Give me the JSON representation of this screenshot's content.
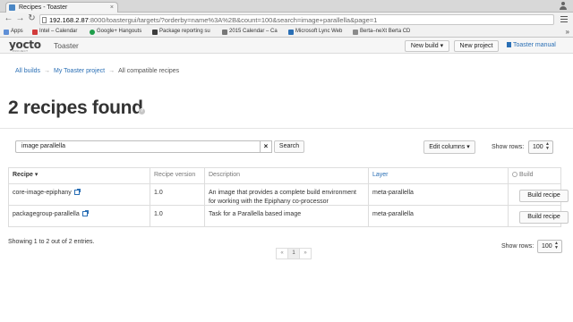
{
  "browser": {
    "tab_title": "Recipes - Toaster",
    "url_host": "192.168.2.87",
    "url_path": ":8000/toastergui/targets/?orderby=name%3A%2B&count=100&search=image+parallella&page=1",
    "bookmarks": [
      {
        "label": "Apps",
        "color": "#5f8fd6"
      },
      {
        "label": "Intel – Calendar",
        "color": "#d23b3b"
      },
      {
        "label": "Google+ Hangouts",
        "color": "#1e9e4a"
      },
      {
        "label": "Package reporting su",
        "color": "#3d3d3d"
      },
      {
        "label": "2015 Calendar – Ca",
        "color": "#777777"
      },
      {
        "label": "Microsoft Lync Web",
        "color": "#2a6fb5"
      },
      {
        "label": "Berta–neXt Berta CD",
        "color": "#8a8a8a"
      }
    ]
  },
  "navbar": {
    "logo": "yocto",
    "logo_sub": "PROJECT",
    "app_title": "Toaster",
    "new_build": "New build ▾",
    "new_project": "New project",
    "manual": "Toaster manual"
  },
  "breadcrumb": {
    "all_builds": "All builds",
    "project": "My Toaster project",
    "current": "All compatible recipes",
    "sep": "→"
  },
  "page": {
    "title": "2 recipes found",
    "help": "?"
  },
  "toolbar": {
    "search_value": "image parallella",
    "clear": "×",
    "search": "Search",
    "edit_columns": "Edit columns ▾",
    "show_rows_label": "Show rows:",
    "show_rows_value": "100"
  },
  "table": {
    "headers": {
      "recipe": "Recipe ▾",
      "version": "Recipe version",
      "description": "Description",
      "layer": "Layer",
      "build": "Build"
    },
    "rows": [
      {
        "recipe": "core-image-epiphany",
        "version": "1.0",
        "description": "An image that provides a complete build environment for working with the Epiphany co-processor",
        "layer": "meta-parallella",
        "build": "Build recipe"
      },
      {
        "recipe": "packagegroup-parallella",
        "version": "1.0",
        "description": "Task for a Parallella based image",
        "layer": "meta-parallella",
        "build": "Build recipe"
      }
    ]
  },
  "footer": {
    "summary": "Showing 1 to 2 out of 2 entries.",
    "show_rows_label": "Show rows:",
    "show_rows_value": "100",
    "pager": {
      "prev": "«",
      "page": "1",
      "next": "»"
    }
  }
}
